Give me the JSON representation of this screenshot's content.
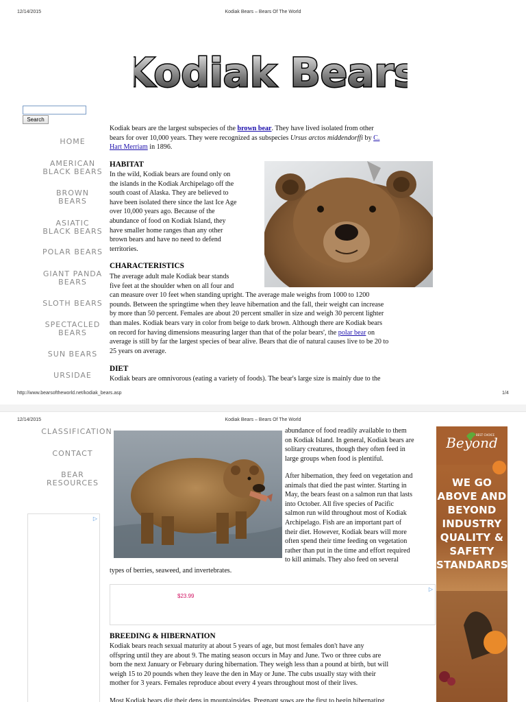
{
  "print_header": {
    "date": "12/14/2015",
    "title": "Kodiak Bears – Bears Of The World"
  },
  "print_footer": {
    "url": "http://www.bearsoftheworld.net/kodiak_bears.asp",
    "page": "1/4"
  },
  "logo_text": "Kodiak Bears",
  "search": {
    "button_label": "Search"
  },
  "nav": {
    "home": "HOME",
    "american_black_bears": [
      "AMERICAN",
      "BLACK BEARS"
    ],
    "brown_bears": [
      "BROWN",
      "BEARS"
    ],
    "asiatic_black_bears": [
      "ASIATIC",
      "BLACK BEARS"
    ],
    "polar_bears": "POLAR BEARS",
    "giant_panda_bears": [
      "GIANT PANDA",
      "BEARS"
    ],
    "sloth_bears": "SLOTH BEARS",
    "spectacled_bears": [
      "SPECTACLED",
      "BEARS"
    ],
    "sun_bears": "SUN BEARS",
    "ursidae": "URSIDAE",
    "classification": "CLASSIFICATION",
    "contact": "CONTACT",
    "bear_resources": [
      "BEAR",
      "RESOURCES"
    ]
  },
  "intro": {
    "l1a": "Kodiak bears are the largest subspecies of the ",
    "l1link": "brown bear",
    "l1b": ". They have lived isolated from other",
    "l2a": "bears for over 10,000 years. They were recognized as subspecies ",
    "l2i": "Ursus arctos middendorffi",
    "l2b": " by ",
    "l2link": "C.",
    "l3link": "Hart Merriam",
    "l3b": " in 1896."
  },
  "habitat": {
    "heading": "HABITAT",
    "lines": [
      "In the wild, Kodiak bears are found only on",
      "the islands in the Kodiak Archipelago off the",
      "south coast of Alaska. They are believed to",
      "have been isolated there since the last Ice Age",
      "over 10,000 years ago. Because of the",
      "abundance of food on Kodiak Island, they",
      "have smaller home ranges than any other",
      "brown bears and have no need to defend",
      "territories."
    ]
  },
  "characteristics": {
    "heading": "CHARACTERISTICS",
    "lines": [
      "The average adult male Kodiak bear stands",
      "five feet at the shoulder when on all four and",
      "can measure over 10 feet when standing upright. The average male weighs from 1000 to 1200",
      "pounds. Between the springtime when they leave hibernation and the fall, their weight can increase",
      "by more than 50 percent. Females are about 20 percent smaller in size and weigh 30 percent lighter",
      "than males. Kodiak bears vary in color from beige to dark brown. Although there are Kodiak bears",
      "on record for having dimensions measuring larger than that of the polar bears', the "
    ],
    "link": "polar bear",
    "after_link": " on",
    "tail_lines": [
      "average is still by far the largest species of bear alive. Bears that die of natural causes live to be 20 to",
      "25 years on average."
    ]
  },
  "diet": {
    "heading": "DIET",
    "line1": "Kodiak bears are omnivorous (eating a variety of foods). The bear's large size is mainly due to the",
    "right_lines": [
      "abundance of food readily available to them",
      "on Kodiak Island. In general, Kodiak bears are",
      "solitary creatures, though they often feed in",
      "large groups when food is plentiful."
    ],
    "p2_lines": [
      "After hibernation, they feed on vegetation and",
      "animals that died the past winter. Starting in",
      "May, the bears feast on a salmon run that lasts",
      "into October. All five species of Pacific",
      "salmon run wild throughout most of Kodiak",
      "Archipelago. Fish are an important part of",
      "their diet. However, Kodiak bears will more",
      "often spend their time feeding on vegetation",
      "rather than put in the time and effort required",
      "to kill animals. They also feed on several"
    ],
    "last_line": "types of berries, seaweed, and invertebrates."
  },
  "ad_inline": {
    "price": "$23.99",
    "marker": "▷"
  },
  "ad_side": {
    "marker": "▷"
  },
  "ad_right": {
    "tag": "BEST CHOICE",
    "brand": "Beyond",
    "lines": [
      "WE GO",
      "ABOVE AND",
      "BEYOND",
      "INDUSTRY",
      "QUALITY &",
      "SAFETY",
      "STANDARDS."
    ]
  },
  "breeding": {
    "heading": "BREEDING & HIBERNATION",
    "lines": [
      "Kodiak bears reach sexual maturity at about 5 years of age, but most females don't have any",
      "offspring until they are about 9. The mating season occurs in May and June. Two or three cubs are",
      "born the next January or February during hibernation. They weigh less than a pound at birth, but will",
      "weigh 15 to 20 pounds when they leave the den in May or June. The cubs usually stay with their",
      "mother for 3 years. Females reproduce about every 4 years throughout most of their lives."
    ],
    "next": "Most Kodiak bears dig their dens in mountainsides. Pregnant sows are the first to begin hibernating"
  },
  "colors": {
    "link": "#1a0dab",
    "nav_text": "#8a8a8a",
    "ad_price": "#d01060"
  }
}
